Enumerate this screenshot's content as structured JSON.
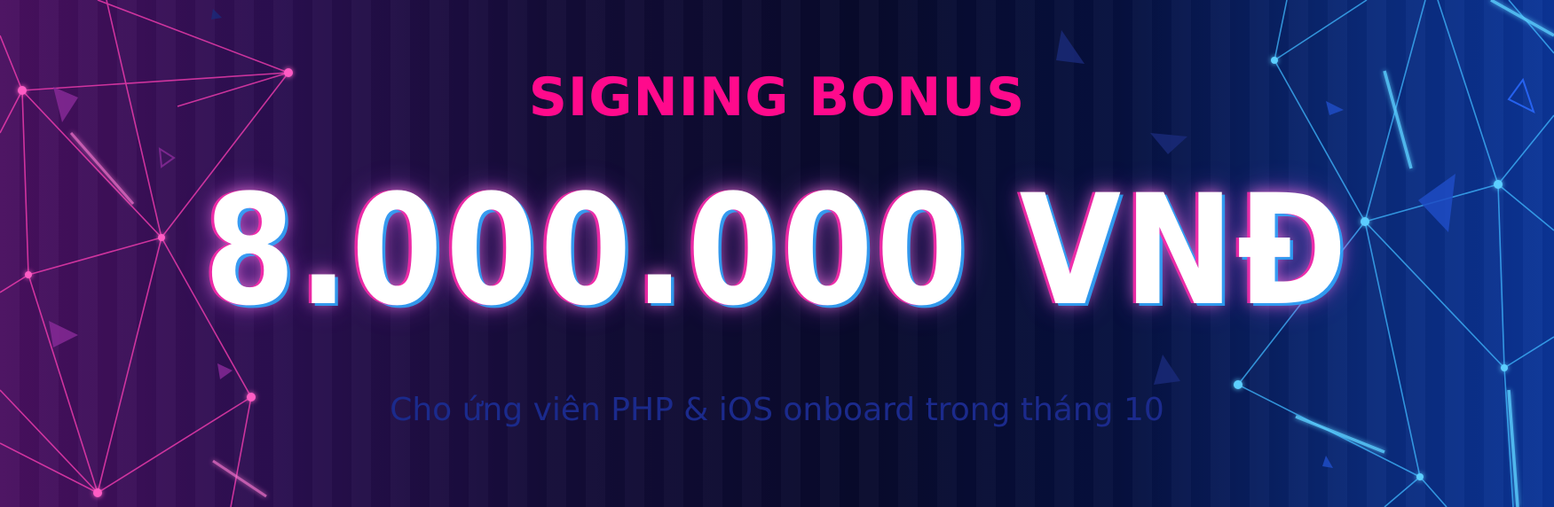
{
  "banner": {
    "heading": "SIGNING BONUS",
    "amount": "8.000.000 VNĐ",
    "subtitle": "Cho ứng viên PHP & iOS onboard trong tháng 10"
  },
  "colors": {
    "heading": "#ff0a8c",
    "amount": "#ffffff",
    "subtitle": "#1b2a8c",
    "left_network": "#ff3fb5",
    "right_network": "#3fb8ff"
  }
}
